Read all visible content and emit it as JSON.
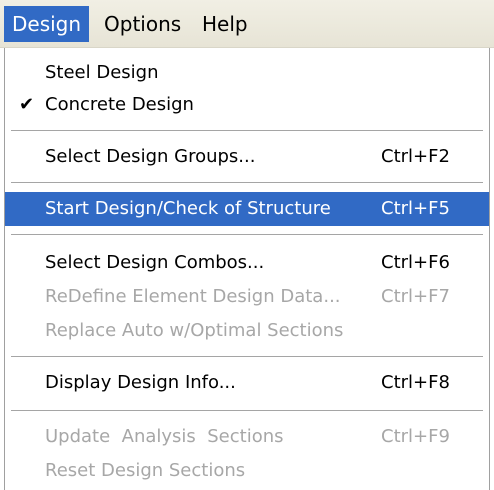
{
  "menubar": {
    "items": [
      {
        "label": "Design",
        "active": true
      },
      {
        "label": "Options",
        "active": false
      },
      {
        "label": "Help",
        "active": false
      }
    ]
  },
  "menu": {
    "items": [
      {
        "label": "Steel Design",
        "shortcut": "",
        "checked": false,
        "disabled": false
      },
      {
        "label": "Concrete Design",
        "shortcut": "",
        "checked": true,
        "disabled": false
      },
      {
        "label": "Select Design Groups...",
        "shortcut": "Ctrl+F2",
        "checked": false,
        "disabled": false
      },
      {
        "label": "Start Design/Check of Structure",
        "shortcut": "Ctrl+F5",
        "checked": false,
        "disabled": false,
        "highlighted": true
      },
      {
        "label": "Select Design Combos...",
        "shortcut": "Ctrl+F6",
        "checked": false,
        "disabled": false
      },
      {
        "label": "ReDefine Element Design Data...",
        "shortcut": "Ctrl+F7",
        "checked": false,
        "disabled": true
      },
      {
        "label": "Replace Auto w/Optimal Sections",
        "shortcut": "",
        "checked": false,
        "disabled": true
      },
      {
        "label": "Display Design Info...",
        "shortcut": "Ctrl+F8",
        "checked": false,
        "disabled": false
      },
      {
        "label": "Update  Analysis  Sections",
        "shortcut": "Ctrl+F9",
        "checked": false,
        "disabled": true
      },
      {
        "label": "Reset Design Sections",
        "shortcut": "",
        "checked": false,
        "disabled": true
      }
    ]
  },
  "colors": {
    "highlight": "#316ac5",
    "disabled_text": "#a7a7a7",
    "menubar_bg": "#ece9d8"
  }
}
